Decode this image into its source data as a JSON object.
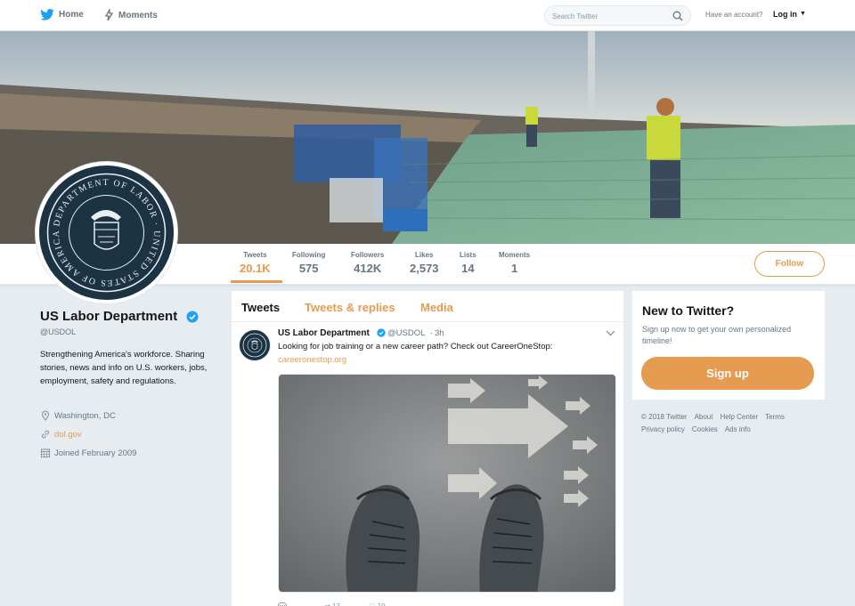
{
  "nav": {
    "home": "Home",
    "moments": "Moments",
    "search_placeholder": "Search Twitter",
    "have_account": "Have an account?",
    "login": "Log in"
  },
  "profile": {
    "name": "US Labor Department",
    "handle": "@USDOL",
    "bio": "Strengthening America's workforce. Sharing stories, news and info on U.S. workers, jobs, employment, safety and regulations.",
    "location": "Washington, DC",
    "website": "dol.gov",
    "joined": "Joined February 2009",
    "seal_text": "DEPARTMENT OF LABOR · UNITED STATES OF AMERICA"
  },
  "stats": [
    {
      "label": "Tweets",
      "value": "20.1K"
    },
    {
      "label": "Following",
      "value": "575"
    },
    {
      "label": "Followers",
      "value": "412K"
    },
    {
      "label": "Likes",
      "value": "2,573"
    },
    {
      "label": "Lists",
      "value": "14"
    },
    {
      "label": "Moments",
      "value": "1"
    }
  ],
  "follow_label": "Follow",
  "timeline": {
    "tabs": [
      "Tweets",
      "Tweets & replies",
      "Media"
    ],
    "tweet": {
      "name": "US Labor Department",
      "handle": "@USDOL",
      "dot": "·",
      "time": "3h",
      "text": "Looking for job training or a new career path? Check out CareerOneStop:",
      "link": "careeronestop.org",
      "retweets": "13",
      "likes": "19"
    }
  },
  "sidebar": {
    "title": "New to Twitter?",
    "subtitle": "Sign up now to get your own personalized timeline!",
    "signup": "Sign up",
    "footer": [
      "© 2018 Twitter",
      "About",
      "Help Center",
      "Terms",
      "Privacy policy",
      "Cookies",
      "Ads info"
    ]
  },
  "colors": {
    "accent": "#e59b50",
    "text": "#14171a",
    "muted": "#657786",
    "background": "#e6ecf0",
    "verified": "#1da1f2"
  }
}
